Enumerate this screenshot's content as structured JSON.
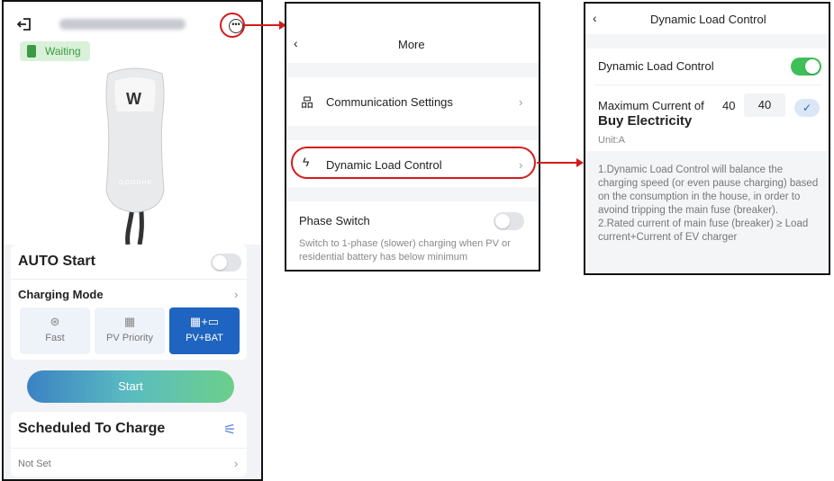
{
  "colors": {
    "accent_red": "#d41b1b",
    "brand_blue": "#1e64c0",
    "toggle_on": "#3fbf58"
  },
  "panel_main": {
    "status_badge": "Waiting",
    "charger_brand": "GOODHE",
    "charger_letter": "W",
    "auto_start_label": "AUTO Start",
    "charging_mode_label": "Charging Mode",
    "modes": [
      {
        "label": "Fast",
        "icon": "fast-charge-icon"
      },
      {
        "label": "PV Priority",
        "icon": "solar-panel-icon"
      },
      {
        "label": "PV+BAT",
        "icon": "solar-battery-icon",
        "selected": true
      }
    ],
    "start_button": "Start",
    "scheduled_label": "Scheduled To Charge",
    "not_set_label": "Not Set"
  },
  "panel_more": {
    "title": "More",
    "communication_settings": "Communication Settings",
    "dynamic_load_control": "Dynamic Load Control",
    "phase_switch_label": "Phase Switch",
    "phase_switch_desc": "Switch to 1-phase (slower) charging when PV or residential battery has below minimum"
  },
  "panel_dlc": {
    "title": "Dynamic Load Control",
    "toggle_label": "Dynamic Load Control",
    "toggle_on": true,
    "max_current_label": "Maximum Current of",
    "max_current_bold": "Buy Electricity",
    "max_current_value": "40",
    "max_current_input": "40",
    "unit_label": "Unit:A",
    "note": "1.Dynamic Load Control will balance the charging speed (or even pause charging) based on the consumption in the house, in order to avoind tripping the main fuse (breaker).\n2.Rated current of main fuse (breaker) ≥ Load current+Current of EV charger"
  }
}
